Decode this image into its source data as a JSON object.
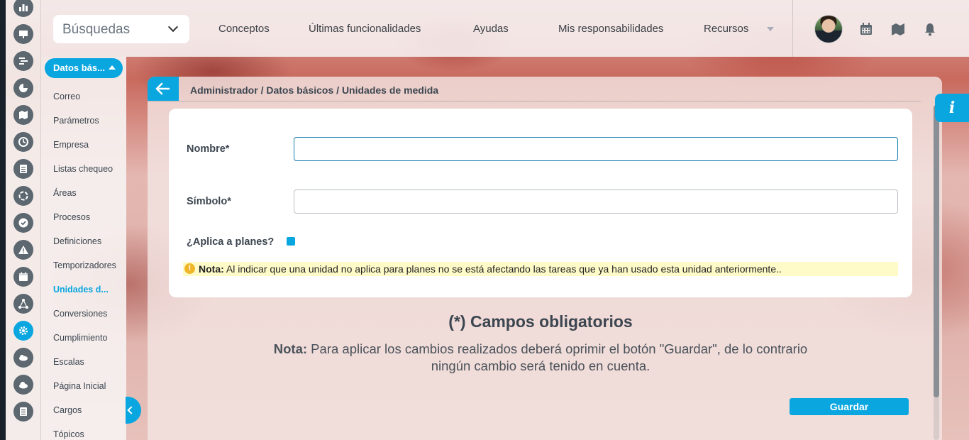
{
  "topbar": {
    "search_select": "Búsquedas",
    "nav": [
      "Conceptos",
      "Últimas funcionalidades",
      "Ayudas",
      "Mis responsabilidades",
      "Recursos"
    ]
  },
  "subnav": {
    "group_label": "Datos bás...",
    "items": [
      "Correo",
      "Parámetros",
      "Empresa",
      "Listas chequeo",
      "Áreas",
      "Procesos",
      "Definiciones",
      "Temporizadores",
      "Unidades d...",
      "Conversiones",
      "Cumplimiento",
      "Escalas",
      "Página Inicial",
      "Cargos",
      "Tópicos"
    ],
    "active_index": 8
  },
  "page": {
    "breadcrumb": "Administrador / Datos básicos / Unidades de medida",
    "form": {
      "name_label": "Nombre*",
      "name_value": "",
      "symbol_label": "Símbolo*",
      "symbol_value": "",
      "applies_label": "¿Aplica a planes?",
      "applies_checked": true
    },
    "note_prefix": "Nota:",
    "note_text": " Al indicar que una unidad no aplica para planes no se está afectando las tareas que ya han usado esta unidad anteriormente..",
    "required_title": "(*) Campos obligatorios",
    "info_prefix": "Nota:",
    "info_text": " Para aplicar los cambios realizados deberá oprimir el botón \"Guardar\", de lo contrario ningún cambio será tenido en cuenta.",
    "save_label": "Guardar"
  },
  "info_tab_label": "i",
  "colors": {
    "accent": "#0aa6e0",
    "note_bg": "#fffbc8",
    "text": "#3c4650"
  }
}
